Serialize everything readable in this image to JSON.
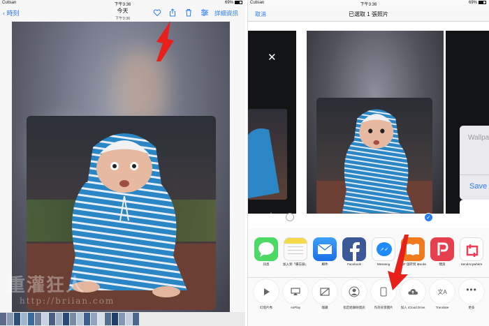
{
  "left_screen": {
    "status": {
      "carrier": "Cutisan",
      "time": "下午3:36",
      "battery": "69%"
    },
    "nav": {
      "back_label": "時刻",
      "title": "今天",
      "subtitle": "下午3:36",
      "edit_label": "詳細資訊"
    },
    "icons": [
      "heart-icon",
      "share-icon",
      "trash-icon",
      "adjust-icon"
    ],
    "watermark": "重灌狂人",
    "watermark_url": "http://briian.com"
  },
  "right_screen": {
    "status": {
      "carrier": "Cutisan",
      "time": "下午3:36",
      "battery": "69%"
    },
    "nav": {
      "cancel_label": "取消",
      "title": "已選取 1 張照片"
    },
    "preview": {
      "close_symbol": "✕",
      "right_card_top": "Wallpa",
      "right_card_save": "Save"
    },
    "apps": [
      {
        "label": "訊息",
        "icon": "messages-icon",
        "color": "#4cd964"
      },
      {
        "label": "加入到「備忘錄」",
        "icon": "notes-icon",
        "color": "#f5d94a"
      },
      {
        "label": "郵件",
        "icon": "mail-icon",
        "color": "#2f86f5"
      },
      {
        "label": "Facebook",
        "icon": "facebook-icon",
        "color": "#3b5998"
      },
      {
        "label": "Messeng",
        "icon": "messenger-icon",
        "color": "#1e8cfc"
      },
      {
        "label": "PDF 儲存到 iBooks",
        "icon": "ibooks-icon",
        "color": "#f07a1e"
      },
      {
        "label": "噗浪",
        "icon": "plurk-icon",
        "color": "#e6404f"
      },
      {
        "label": "SendAnywhere",
        "icon": "sendanywhere-icon",
        "color": "#ee3d57"
      }
    ],
    "actions": [
      {
        "label": "幻燈片秀",
        "icon": "play-icon"
      },
      {
        "label": "AirPlay",
        "icon": "airplay-icon"
      },
      {
        "label": "隱藏",
        "icon": "hide-icon"
      },
      {
        "label": "指定給聯絡資訊",
        "icon": "contact-icon"
      },
      {
        "label": "作為背景圖片",
        "icon": "wallpaper-icon"
      },
      {
        "label": "加入 iCloud Drive",
        "icon": "icloud-icon"
      },
      {
        "label": "Translate",
        "icon": "translate-icon"
      },
      {
        "label": "更多",
        "icon": "more-icon"
      }
    ]
  },
  "colors": {
    "accent": "#2a7cf6",
    "arrow": "#e8201c"
  }
}
